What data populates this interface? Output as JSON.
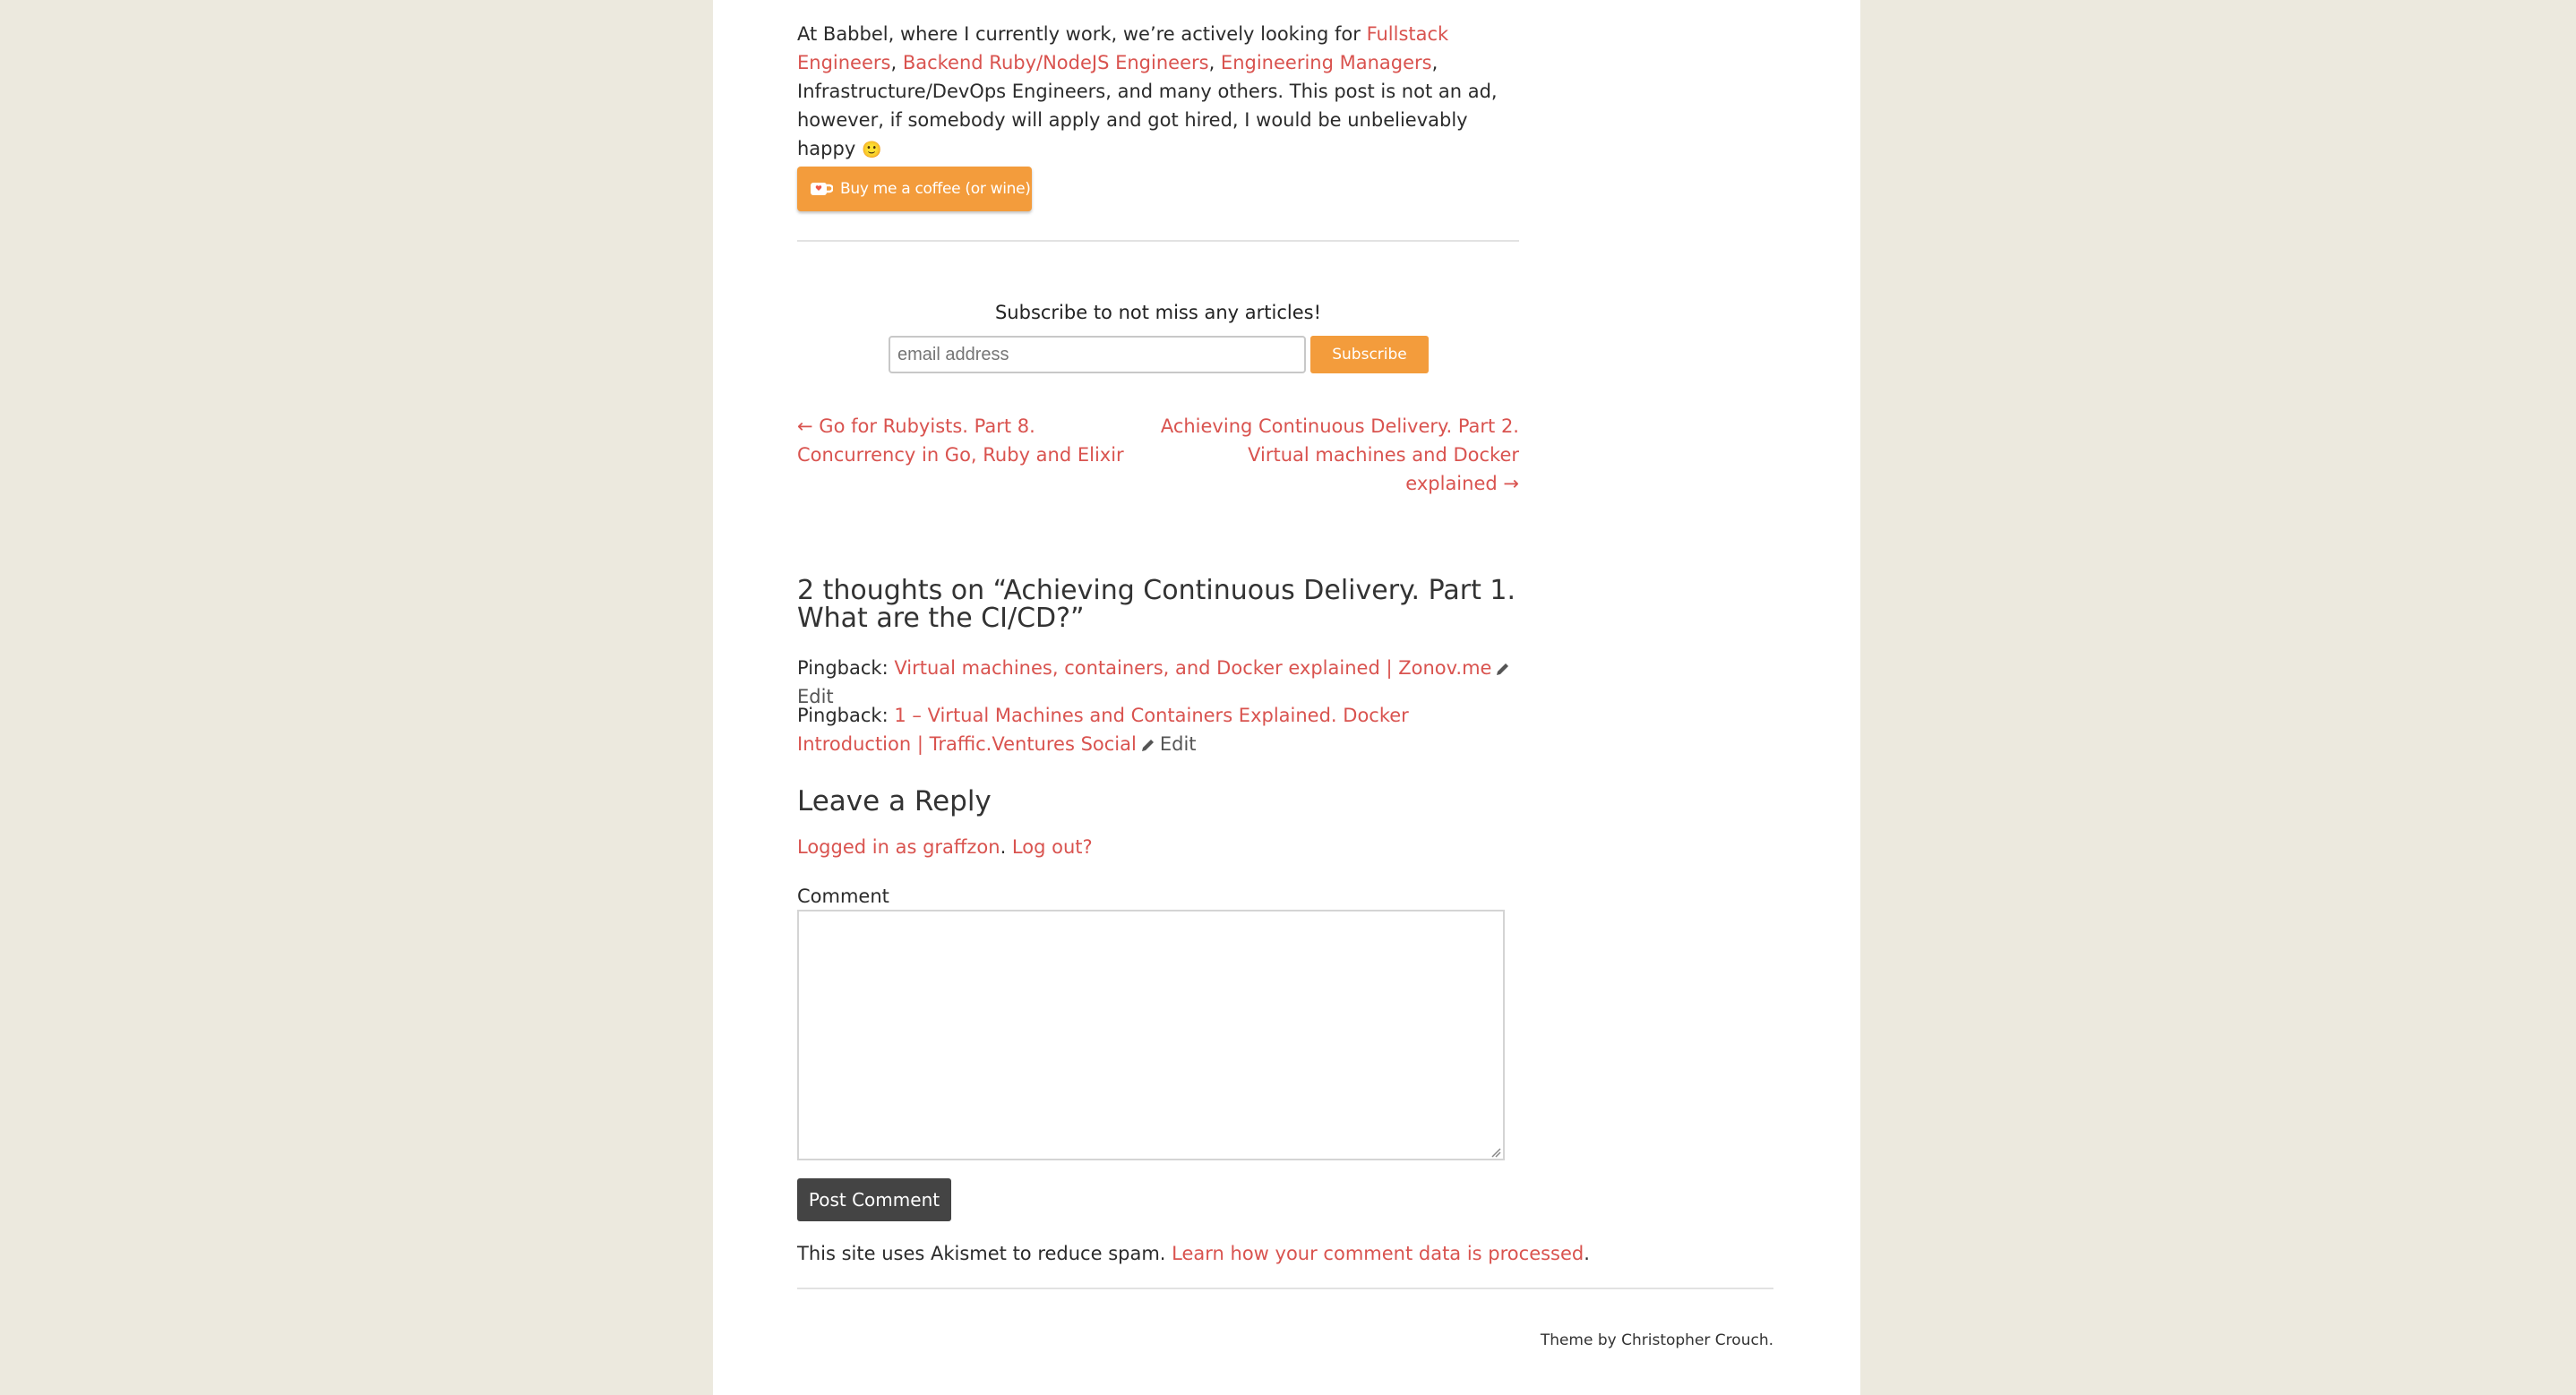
{
  "post": {
    "intro_before": "At Babbel, where I currently work, we’re actively looking for ",
    "job_link_1": "Fullstack Engineers",
    "sep_1": ", ",
    "job_link_2": "Backend Ruby/NodeJS Engineers",
    "sep_2": ", ",
    "job_link_3": "Engineering Managers",
    "intro_after": ", Infrastructure/DevOps Engineers, and many others. This post is not an ad, however, if somebody will apply and got hired, I would be unbelievably happy",
    "emoji": "🙂"
  },
  "kofi": {
    "label": "Buy me a coffee (or wine)",
    "icon": "coffee-cup-icon"
  },
  "subscribe": {
    "title": "Subscribe to not miss any articles!",
    "email_placeholder": "email address",
    "email_value": "",
    "button_label": "Subscribe"
  },
  "post_nav": {
    "prev_arrow": "←",
    "prev_label": "Go for Rubyists. Part 8. Concurrency in Go, Ruby and Elixir",
    "next_label": "Achieving Continuous Delivery. Part 2. Virtual machines and Docker explained",
    "next_arrow": "→"
  },
  "comments": {
    "title": "2 thoughts on “Achieving Continuous Delivery. Part 1. What are the CI/CD?”",
    "pingbacks": [
      {
        "prefix": "Pingback:",
        "link": "Virtual machines, containers, and Docker explained | Zonov.me",
        "edit": "Edit"
      },
      {
        "prefix": "Pingback:",
        "link": "1 – Virtual Machines and Containers Explained. Docker Introduction | Traffic.Ventures Social",
        "edit": "Edit"
      }
    ]
  },
  "reply": {
    "title": "Leave a Reply",
    "logged_in_link": "Logged in as graffzon",
    "logged_sep": ". ",
    "logout_link": "Log out?",
    "comment_label": "Comment",
    "comment_value": "",
    "submit_label": "Post Comment",
    "akismet_text": "This site uses Akismet to reduce spam. ",
    "akismet_link": "Learn how your comment data is processed",
    "akismet_end": "."
  },
  "footer": {
    "credit": "Theme by Christopher Crouch."
  },
  "colors": {
    "link": "#d9534f",
    "accent": "#f39c3c",
    "background": "#ece9de",
    "button_dark": "#444444"
  }
}
